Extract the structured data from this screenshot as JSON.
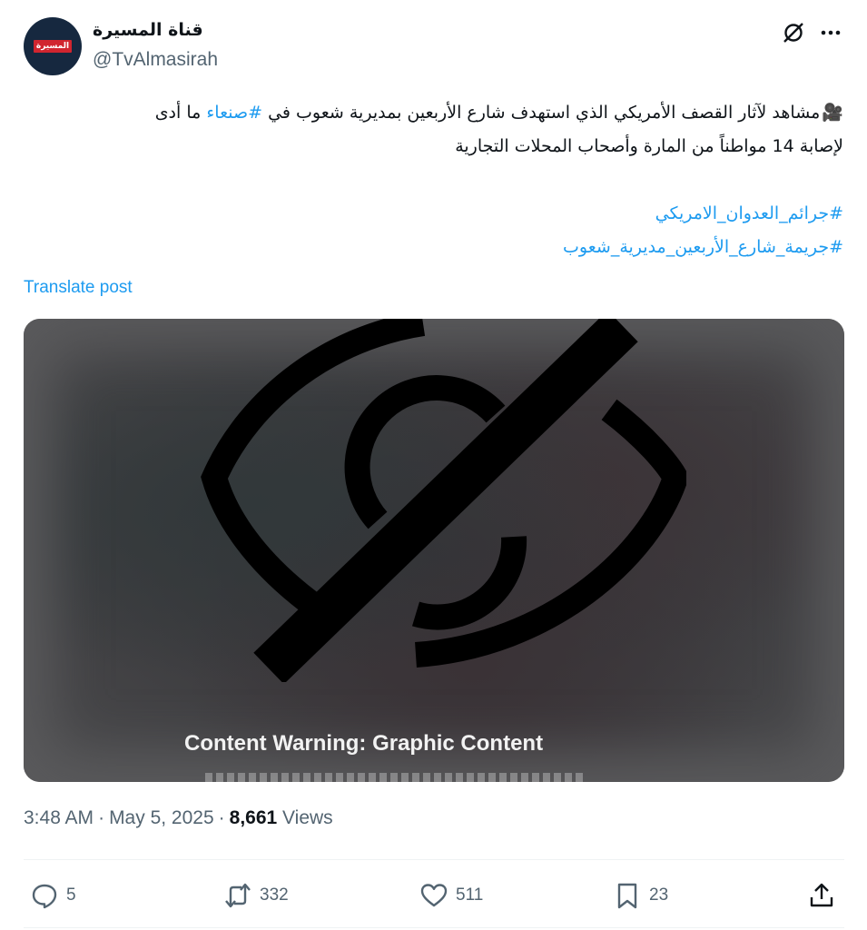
{
  "author": {
    "display_name": "قناة المسيرة",
    "handle": "@TvAlmasirah",
    "avatar_logo_text": "المسيرة"
  },
  "post": {
    "line1_emoji": "🎥",
    "line1_a": "مشاهد لآثار القصف الأمريكي الذي استهدف شارع الأربعين بمديرية شعوب في ",
    "line1_hashtag": "#صنعاء",
    "line1_b": " ما أدى",
    "line2": "لإصابة 14 مواطناً من المارة وأصحاب المحلات التجارية",
    "hashtag1": "#جرائم_العدوان_الامريكي",
    "hashtag2": "#جريمة_شارع_الأربعين_مديرية_شعوب"
  },
  "translate_label": "Translate post",
  "media": {
    "warning_label": "Content Warning: Graphic Content"
  },
  "meta": {
    "time": "3:48 AM",
    "date": "May 5, 2025",
    "views_count": "8,661",
    "views_label": "Views"
  },
  "actions": {
    "replies": "5",
    "reposts": "332",
    "likes": "511",
    "bookmarks": "23"
  },
  "colors": {
    "link": "#1d9bf0",
    "secondary_text": "#536471",
    "primary_text": "#0f1419"
  }
}
